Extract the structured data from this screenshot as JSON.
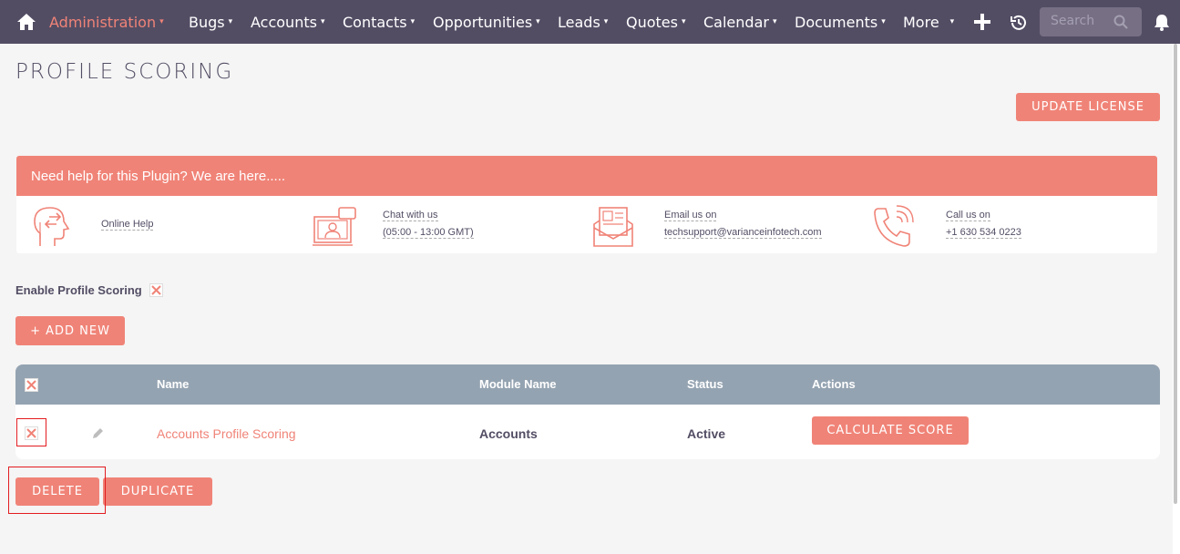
{
  "nav": {
    "items": [
      {
        "label": "Administration",
        "active": true
      },
      {
        "label": "Bugs"
      },
      {
        "label": "Accounts"
      },
      {
        "label": "Contacts"
      },
      {
        "label": "Opportunities"
      },
      {
        "label": "Leads"
      },
      {
        "label": "Quotes"
      },
      {
        "label": "Calendar"
      },
      {
        "label": "Documents"
      },
      {
        "label": "More"
      }
    ],
    "caret": "▾",
    "search_placeholder": "Search"
  },
  "page": {
    "title": "PROFILE SCORING"
  },
  "buttons": {
    "update_license": "UPDATE LICENSE",
    "add_new": "+ ADD NEW",
    "calculate_score": "CALCULATE SCORE",
    "delete": "DELETE",
    "duplicate": "DUPLICATE"
  },
  "help": {
    "header": "Need help for this Plugin? We are here.....",
    "online_help": "Online Help",
    "chat_line1": "Chat with us",
    "chat_line2": "(05:00 - 13:00 GMT)",
    "email_line1": "Email us on",
    "email_line2": "techsupport@varianceinfotech.com",
    "call_line1": "Call us on",
    "call_line2": "+1 630 534 0223"
  },
  "enable": {
    "label": "Enable Profile Scoring"
  },
  "table": {
    "columns": [
      "Name",
      "Module Name",
      "Status",
      "Actions"
    ],
    "rows": [
      {
        "name": "Accounts Profile Scoring",
        "module": "Accounts",
        "status": "Active"
      }
    ]
  },
  "colors": {
    "accent": "#f08377",
    "nav_bg": "#534d64",
    "table_header": "#94a3b1",
    "highlight": "#e21c20"
  }
}
